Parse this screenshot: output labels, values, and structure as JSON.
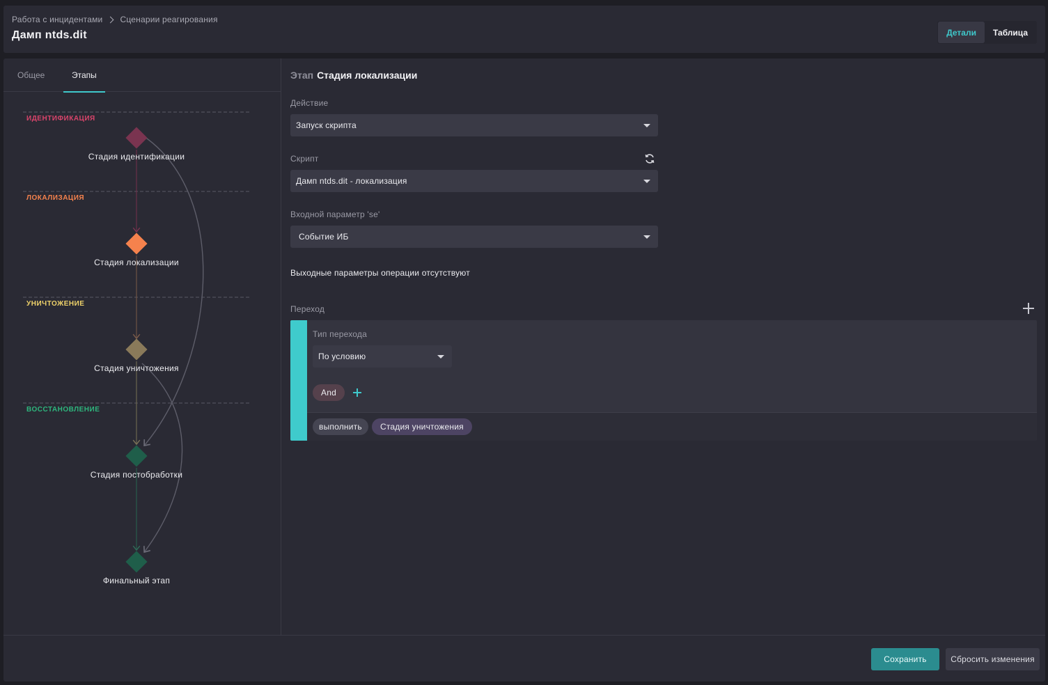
{
  "breadcrumb": {
    "parent": "Работа с инцидентами",
    "current": "Сценарии реагирования"
  },
  "page_title": "Дамп ntds.dit",
  "view_switch": {
    "details": "Детали",
    "table": "Таблица",
    "active": "details"
  },
  "left_tabs": {
    "general": "Общее",
    "stages": "Этапы",
    "active": "stages"
  },
  "flow": {
    "lanes": [
      {
        "label": "ИДЕНТИФИКАЦИЯ",
        "color": "#d9446b"
      },
      {
        "label": "ЛОКАЛИЗАЦИЯ",
        "color": "#f5824d"
      },
      {
        "label": "УНИЧТОЖЕНИЕ",
        "color": "#f0d36a"
      },
      {
        "label": "ВОССТАНОВЛЕНИЕ",
        "color": "#2eb67d"
      }
    ],
    "nodes": [
      {
        "label": "Стадия идентификации",
        "color": "#7a3450"
      },
      {
        "label": "Стадия локализации",
        "color": "#f5824d"
      },
      {
        "label": "Стадия уничтожения",
        "color": "#8a7a5a"
      },
      {
        "label": "Стадия постобработки",
        "color": "#1f5e4a"
      },
      {
        "label": "Финальный этап",
        "color": "#1f5e4a"
      }
    ]
  },
  "stage": {
    "prefix": "Этап",
    "name": "Стадия локализации",
    "action_label": "Действие",
    "action_value": "Запуск скрипта",
    "script_label": "Скрипт",
    "script_value": "Дамп ntds.dit - локализация",
    "input_label": "Входной параметр 'se'",
    "input_value": "Событие ИБ",
    "output_info": "Выходные параметры операции отсутствуют",
    "transition_label": "Переход"
  },
  "transition": {
    "type_label": "Тип перехода",
    "type_value": "По условию",
    "operator": "And",
    "action_chip": "выполнить",
    "target_chip": "Стадия уничтожения",
    "accent_color": "#3fcbcc"
  },
  "footer": {
    "save": "Сохранить",
    "reset": "Сбросить изменения"
  }
}
